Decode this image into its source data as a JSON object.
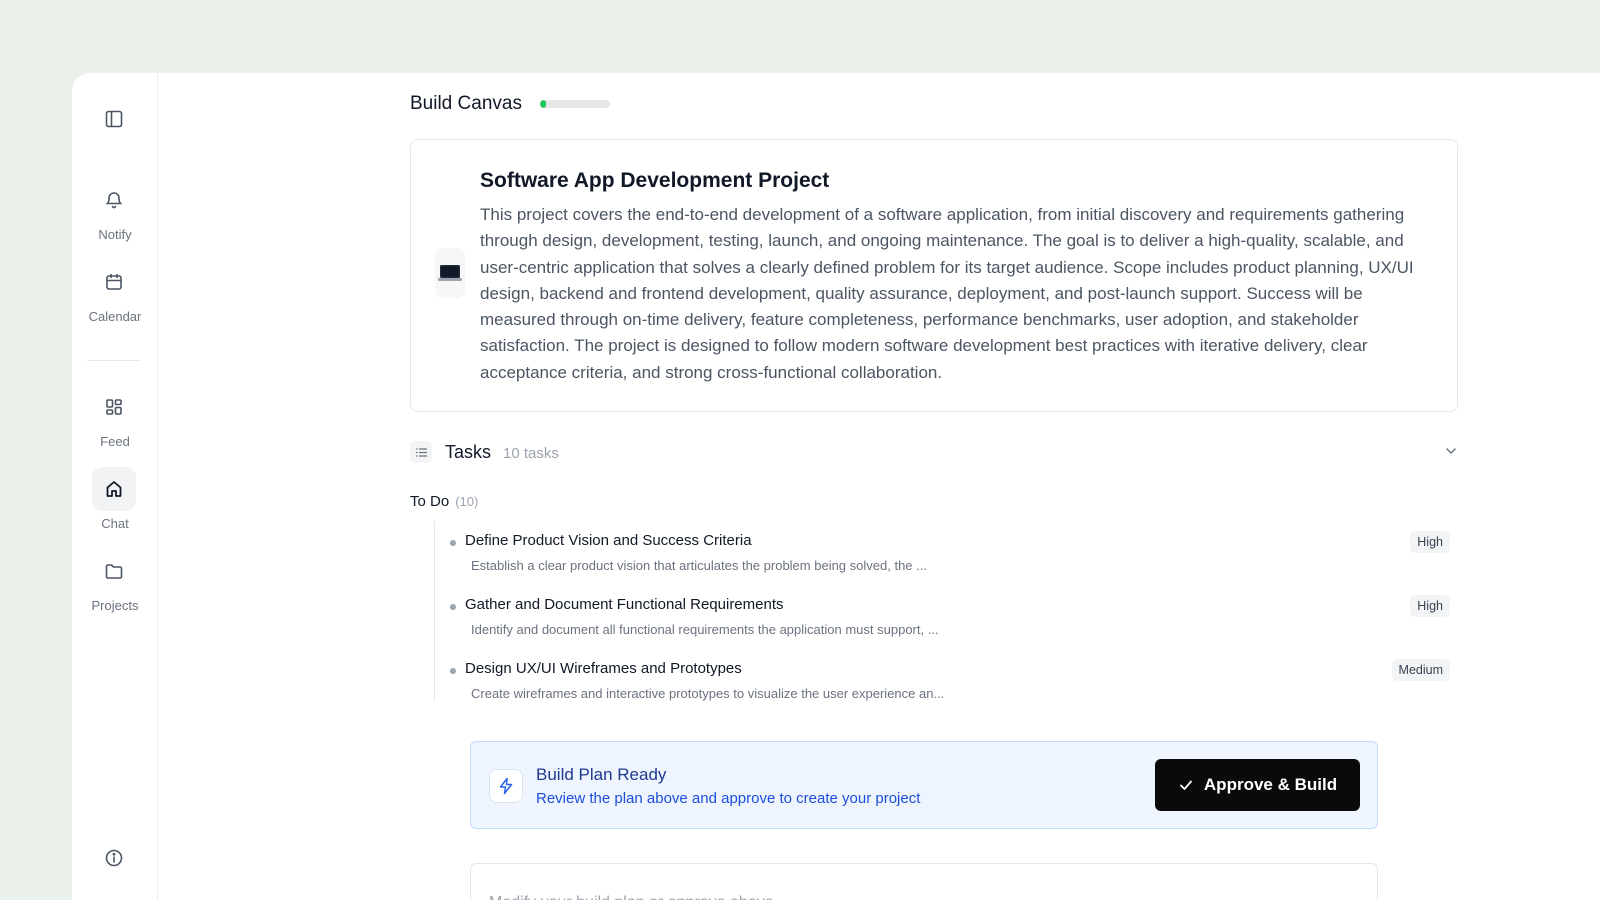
{
  "sidebar": {
    "items": [
      {
        "label": "Notify",
        "icon": "bell-icon"
      },
      {
        "label": "Calendar",
        "icon": "calendar-icon"
      },
      {
        "label": "Feed",
        "icon": "grid-icon"
      },
      {
        "label": "Chat",
        "icon": "home-icon",
        "active": true
      },
      {
        "label": "Projects",
        "icon": "folder-icon"
      }
    ]
  },
  "canvas": {
    "title": "Build Canvas",
    "progress_percent": 8
  },
  "project": {
    "icon": "laptop-icon",
    "title": "Software App Development Project",
    "description": "This project covers the end-to-end development of a software application, from initial discovery and requirements gathering through design, development, testing, launch, and ongoing maintenance. The goal is to deliver a high-quality, scalable, and user-centric application that solves a clearly defined problem for its target audience. Scope includes product planning, UX/UI design, backend and frontend development, quality assurance, deployment, and post-launch support. Success will be measured through on-time delivery, feature completeness, performance benchmarks, user adoption, and stakeholder satisfaction. The project is designed to follow modern software development best practices with iterative delivery, clear acceptance criteria, and strong cross-functional collaboration."
  },
  "tasks": {
    "title": "Tasks",
    "count_label": "10 tasks",
    "group_label": "To Do",
    "group_count": "(10)",
    "items": [
      {
        "title": "Define Product Vision and Success Criteria",
        "desc": "Establish a clear product vision that articulates the problem being solved, the ...",
        "priority": "High"
      },
      {
        "title": "Gather and Document Functional Requirements",
        "desc": "Identify and document all functional requirements the application must support, ...",
        "priority": "High"
      },
      {
        "title": "Design UX/UI Wireframes and Prototypes",
        "desc": "Create wireframes and interactive prototypes to visualize the user experience an...",
        "priority": "Medium"
      }
    ]
  },
  "plan": {
    "title": "Build Plan Ready",
    "subtitle": "Review the plan above and approve to create your project",
    "approve_label": "Approve & Build"
  },
  "input": {
    "placeholder": "Modify your build plan or approve above..."
  },
  "colors": {
    "accent_green": "#22c55e",
    "plan_bg": "#eef5ff",
    "plan_border": "#bfdbfe",
    "plan_text": "#1e3a8a",
    "button_bg": "#0a0a0a"
  }
}
